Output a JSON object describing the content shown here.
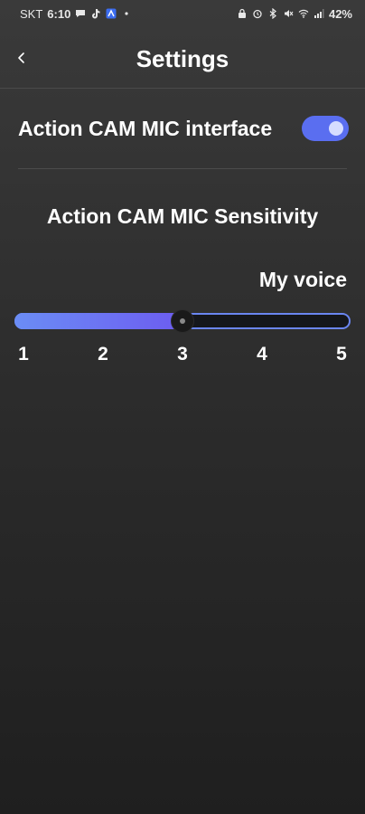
{
  "status_bar": {
    "carrier": "SKT",
    "time": "6:10",
    "battery": "42%",
    "left_icons": [
      "chat-icon",
      "tiktok-icon",
      "app-icon",
      "dot-icon"
    ],
    "right_icons": [
      "lock-icon",
      "alarm-icon",
      "bluetooth-icon",
      "mute-icon",
      "wifi-icon",
      "signal-icon"
    ]
  },
  "header": {
    "title": "Settings",
    "back_icon": "chevron-left-icon"
  },
  "interface": {
    "label": "Action CAM MIC interface",
    "enabled": true,
    "accent_color": "#5a6ef0"
  },
  "sensitivity": {
    "title": "Action CAM MIC Sensitivity",
    "value_label": "My voice",
    "min": 1,
    "max": 5,
    "value": 3,
    "ticks": [
      "1",
      "2",
      "3",
      "4",
      "5"
    ]
  }
}
